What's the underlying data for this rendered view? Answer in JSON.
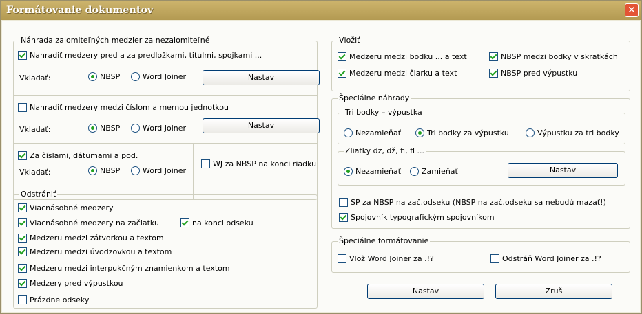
{
  "window": {
    "title": "Formátovanie dokumentov",
    "close_glyph": "✕"
  },
  "group_replace": {
    "legend": "Náhrada zalomiteľných medzier za nezalomiteľné",
    "cb_prepositions": "Nahradiť medzery pred a za predložkami, titulmi, spojkami ...",
    "insert_label_1": "Vkladať:",
    "radio_nbsp_1": "NBSP",
    "radio_wj_1": "Word Joiner",
    "nastav_1": "Nastav",
    "cb_number_unit": "Nahradiť medzery medzi číslom a mernou jednotkou",
    "insert_label_2": "Vkladať:",
    "radio_nbsp_2": "NBSP",
    "radio_wj_2": "Word Joiner",
    "nastav_2": "Nastav",
    "cb_after_numbers": "Za číslami, dátumami a pod.",
    "insert_label_3": "Vkladať:",
    "radio_nbsp_3": "NBSP",
    "radio_wj_3": "Word Joiner",
    "cb_wj_end": "WJ za NBSP na konci riadku"
  },
  "group_remove": {
    "legend": "Odstrániť",
    "items": [
      "Viacnásobné medzery",
      "Viacnásobné medzery na začiatku",
      "na konci odseku",
      "Medzeru medzi zátvorkou a textom",
      "Medzeru medzi úvodzovkou a textom",
      "Medzeru medzi interpukčným znamienkom a textom",
      "Medzery pred výpustkou",
      "Prázdne odseky"
    ]
  },
  "group_insert": {
    "legend": "Vložiť",
    "cb_dot_text": "Medzeru medzi bodku ... a text",
    "cb_nbsp_abbrev": "NBSP medzi bodky v skratkách",
    "cb_dash_text": "Medzeru medzi čiarku a text",
    "cb_nbsp_ellipsis": "NBSP pred výpustku"
  },
  "group_special": {
    "legend": "Špeciálne náhrady",
    "three_dots": {
      "legend": "Tri bodky – výpustka",
      "opt_keep": "Nezamieňať",
      "opt_to_ellipsis": "Tri bodky za výpustku",
      "opt_to_dots": "Výpustku za tri bodky"
    },
    "ligatures": {
      "legend": "Zliatky dz, dž, fi, fl ...",
      "opt_keep": "Nezamieňať",
      "opt_replace": "Zamieňať",
      "nastav": "Nastav"
    },
    "cb_sp_nbsp": "SP za NBSP na zač.odseku (NBSP na zač.odseku sa nebudú mazať!)",
    "cb_hyphen": "Spojovník typografickým spojovníkom"
  },
  "group_format": {
    "legend": "Špeciálne formátovanie",
    "cb_insert_wj": "Vlož Word Joiner za .!?",
    "cb_remove_wj": "Odstráň Word Joiner za .!?"
  },
  "buttons": {
    "nastav": "Nastav",
    "zrus": "Zruš"
  }
}
